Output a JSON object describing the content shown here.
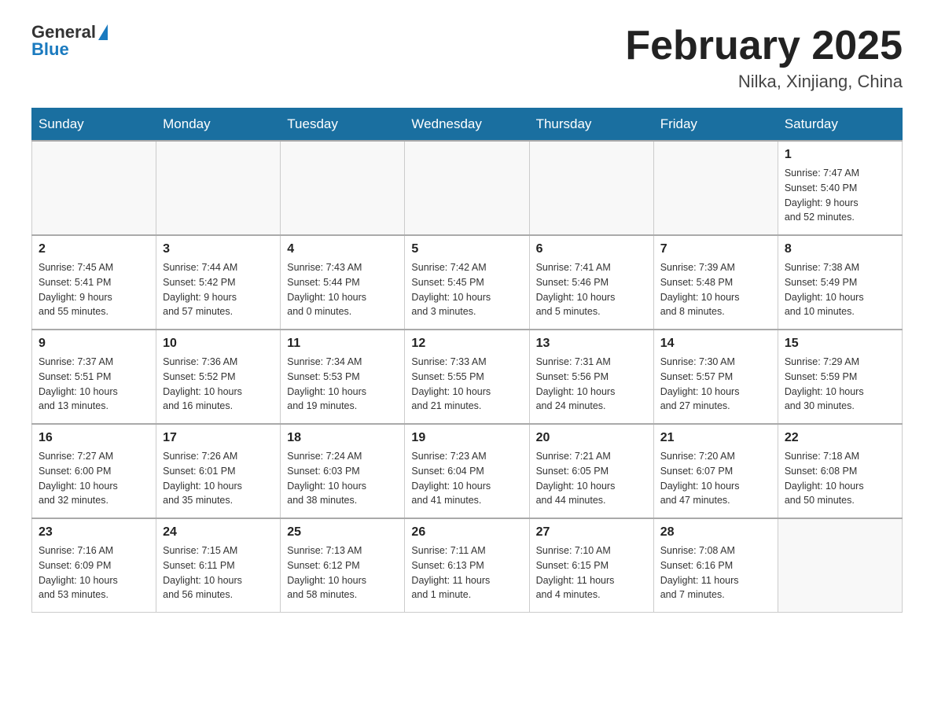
{
  "header": {
    "logo_text_general": "General",
    "logo_text_blue": "Blue",
    "month_title": "February 2025",
    "location": "Nilka, Xinjiang, China"
  },
  "weekdays": [
    "Sunday",
    "Monday",
    "Tuesday",
    "Wednesday",
    "Thursday",
    "Friday",
    "Saturday"
  ],
  "weeks": [
    [
      {
        "day": "",
        "info": ""
      },
      {
        "day": "",
        "info": ""
      },
      {
        "day": "",
        "info": ""
      },
      {
        "day": "",
        "info": ""
      },
      {
        "day": "",
        "info": ""
      },
      {
        "day": "",
        "info": ""
      },
      {
        "day": "1",
        "info": "Sunrise: 7:47 AM\nSunset: 5:40 PM\nDaylight: 9 hours\nand 52 minutes."
      }
    ],
    [
      {
        "day": "2",
        "info": "Sunrise: 7:45 AM\nSunset: 5:41 PM\nDaylight: 9 hours\nand 55 minutes."
      },
      {
        "day": "3",
        "info": "Sunrise: 7:44 AM\nSunset: 5:42 PM\nDaylight: 9 hours\nand 57 minutes."
      },
      {
        "day": "4",
        "info": "Sunrise: 7:43 AM\nSunset: 5:44 PM\nDaylight: 10 hours\nand 0 minutes."
      },
      {
        "day": "5",
        "info": "Sunrise: 7:42 AM\nSunset: 5:45 PM\nDaylight: 10 hours\nand 3 minutes."
      },
      {
        "day": "6",
        "info": "Sunrise: 7:41 AM\nSunset: 5:46 PM\nDaylight: 10 hours\nand 5 minutes."
      },
      {
        "day": "7",
        "info": "Sunrise: 7:39 AM\nSunset: 5:48 PM\nDaylight: 10 hours\nand 8 minutes."
      },
      {
        "day": "8",
        "info": "Sunrise: 7:38 AM\nSunset: 5:49 PM\nDaylight: 10 hours\nand 10 minutes."
      }
    ],
    [
      {
        "day": "9",
        "info": "Sunrise: 7:37 AM\nSunset: 5:51 PM\nDaylight: 10 hours\nand 13 minutes."
      },
      {
        "day": "10",
        "info": "Sunrise: 7:36 AM\nSunset: 5:52 PM\nDaylight: 10 hours\nand 16 minutes."
      },
      {
        "day": "11",
        "info": "Sunrise: 7:34 AM\nSunset: 5:53 PM\nDaylight: 10 hours\nand 19 minutes."
      },
      {
        "day": "12",
        "info": "Sunrise: 7:33 AM\nSunset: 5:55 PM\nDaylight: 10 hours\nand 21 minutes."
      },
      {
        "day": "13",
        "info": "Sunrise: 7:31 AM\nSunset: 5:56 PM\nDaylight: 10 hours\nand 24 minutes."
      },
      {
        "day": "14",
        "info": "Sunrise: 7:30 AM\nSunset: 5:57 PM\nDaylight: 10 hours\nand 27 minutes."
      },
      {
        "day": "15",
        "info": "Sunrise: 7:29 AM\nSunset: 5:59 PM\nDaylight: 10 hours\nand 30 minutes."
      }
    ],
    [
      {
        "day": "16",
        "info": "Sunrise: 7:27 AM\nSunset: 6:00 PM\nDaylight: 10 hours\nand 32 minutes."
      },
      {
        "day": "17",
        "info": "Sunrise: 7:26 AM\nSunset: 6:01 PM\nDaylight: 10 hours\nand 35 minutes."
      },
      {
        "day": "18",
        "info": "Sunrise: 7:24 AM\nSunset: 6:03 PM\nDaylight: 10 hours\nand 38 minutes."
      },
      {
        "day": "19",
        "info": "Sunrise: 7:23 AM\nSunset: 6:04 PM\nDaylight: 10 hours\nand 41 minutes."
      },
      {
        "day": "20",
        "info": "Sunrise: 7:21 AM\nSunset: 6:05 PM\nDaylight: 10 hours\nand 44 minutes."
      },
      {
        "day": "21",
        "info": "Sunrise: 7:20 AM\nSunset: 6:07 PM\nDaylight: 10 hours\nand 47 minutes."
      },
      {
        "day": "22",
        "info": "Sunrise: 7:18 AM\nSunset: 6:08 PM\nDaylight: 10 hours\nand 50 minutes."
      }
    ],
    [
      {
        "day": "23",
        "info": "Sunrise: 7:16 AM\nSunset: 6:09 PM\nDaylight: 10 hours\nand 53 minutes."
      },
      {
        "day": "24",
        "info": "Sunrise: 7:15 AM\nSunset: 6:11 PM\nDaylight: 10 hours\nand 56 minutes."
      },
      {
        "day": "25",
        "info": "Sunrise: 7:13 AM\nSunset: 6:12 PM\nDaylight: 10 hours\nand 58 minutes."
      },
      {
        "day": "26",
        "info": "Sunrise: 7:11 AM\nSunset: 6:13 PM\nDaylight: 11 hours\nand 1 minute."
      },
      {
        "day": "27",
        "info": "Sunrise: 7:10 AM\nSunset: 6:15 PM\nDaylight: 11 hours\nand 4 minutes."
      },
      {
        "day": "28",
        "info": "Sunrise: 7:08 AM\nSunset: 6:16 PM\nDaylight: 11 hours\nand 7 minutes."
      },
      {
        "day": "",
        "info": ""
      }
    ]
  ]
}
